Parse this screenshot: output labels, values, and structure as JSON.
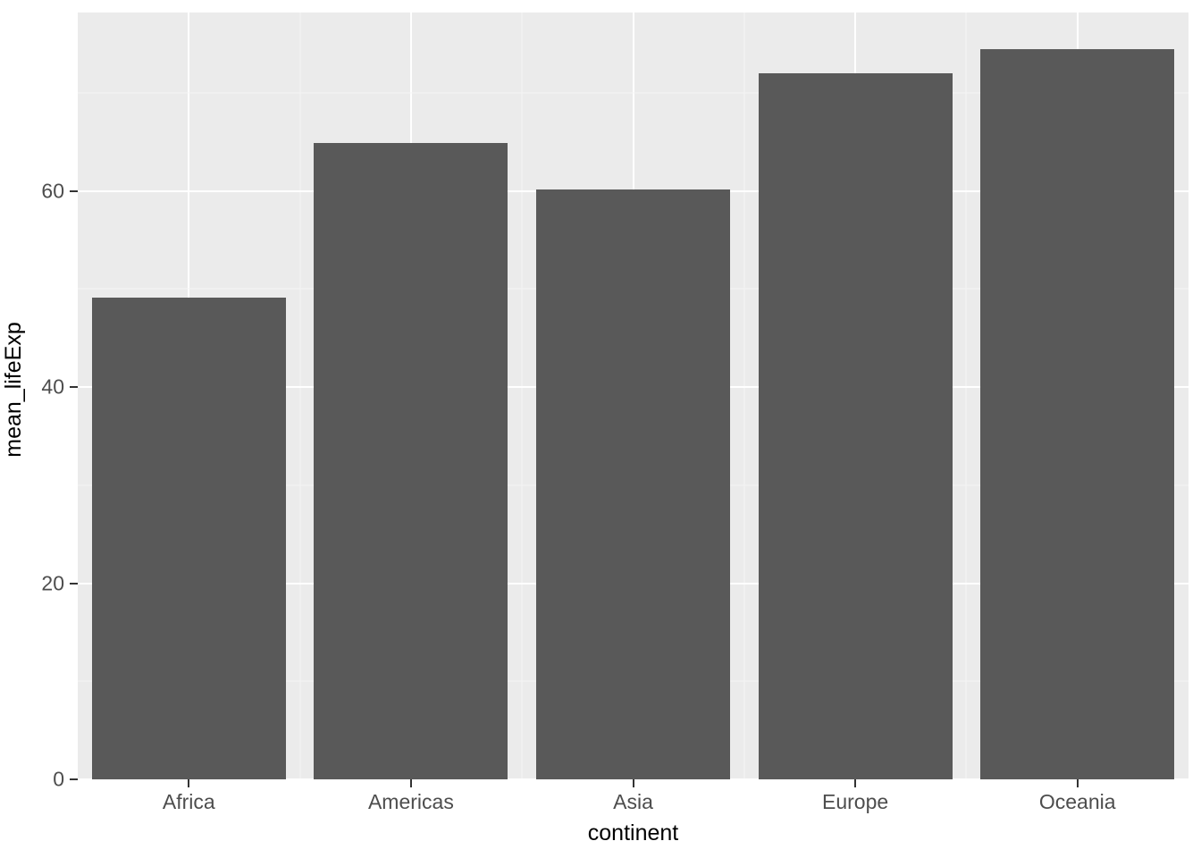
{
  "chart_data": {
    "type": "bar",
    "title": "",
    "subtitle": "",
    "xlabel": "continent",
    "ylabel": "mean_lifeExp",
    "categories": [
      "Africa",
      "Americas",
      "Asia",
      "Europe",
      "Oceania"
    ],
    "values": [
      49.1,
      64.9,
      60.2,
      72.0,
      74.5
    ],
    "series": [
      {
        "name": "mean_lifeExp",
        "values": [
          49.1,
          64.9,
          60.2,
          72.0,
          74.5
        ]
      }
    ],
    "ylim": [
      0,
      78.2
    ],
    "y_ticks": [
      0,
      20,
      40,
      60
    ],
    "y_tick_labels": [
      "0",
      "20",
      "40",
      "60"
    ],
    "y_minor_ticks": [
      10,
      30,
      50,
      70
    ],
    "grid": true,
    "legend": "none",
    "legend_position": "none",
    "bar_color": "#595959",
    "panel_background": "#EBEBEB",
    "grid_major_color": "#FFFFFF",
    "grid_minor_color": "#F5F5F5",
    "axis_text_color": "#4D4D4D",
    "axis_title_color": "#000000",
    "plot_background": "#FFFFFF"
  }
}
